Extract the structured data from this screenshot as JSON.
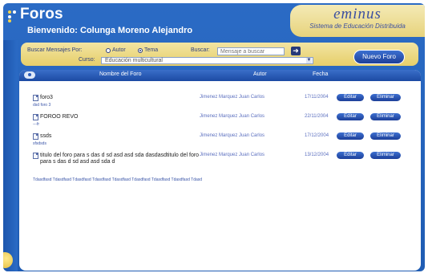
{
  "header": {
    "title": "Foros",
    "welcome": "Bienvenido: Colunga Moreno Alejandro",
    "brand_name": "eminus",
    "brand_subtitle": "Sistema de Educación Distribuida"
  },
  "search": {
    "label": "Buscar Mensajes Por:",
    "option_author": "Autor",
    "option_topic": "Tema",
    "selected_option": "Tema",
    "buscar_label": "Buscar:",
    "placeholder": "Mensaje a buscar",
    "course_label": "Curso:",
    "course_value": "Educación multicultural"
  },
  "actions": {
    "new_forum": "Nuevo Foro"
  },
  "table": {
    "columns": [
      "Nombre del Foro",
      "Autor",
      "Fecha"
    ],
    "rows": [
      {
        "title": "foro3",
        "sub": "dsd foro 3",
        "author": "Jimenez Marquez Juan Carlos",
        "date": "17/11/2004",
        "edit": "Editar",
        "delete": "Eliminar"
      },
      {
        "title": "FOROO REVO",
        "sub": "---fr",
        "author": "Jimenez Marquez Juan Carlos",
        "date": "22/11/2004",
        "edit": "Editar",
        "delete": "Eliminar"
      },
      {
        "title": "ssds",
        "sub": "sfsdsds",
        "author": "Jimenez Marquez Juan Carlos",
        "date": "17/12/2004",
        "edit": "Editar",
        "delete": "Eliminar"
      },
      {
        "title": "titulo del foro para s das d sd asd asd sda dasdasdtitulo del foro para s das d sd asd asd sda d",
        "sub": "Tdasdfasd Tdasdfasd Tdasdfasd Tdasdfasd Tdasdfasd Tdasdfasd Tdasdfasd Tdasdfasd Tdasd",
        "author": "Jimenez Marquez Juan Carlos",
        "date": "13/12/2004",
        "edit": "Editar",
        "delete": "Eliminar"
      }
    ]
  },
  "colors": {
    "frame": "#2b6bc5",
    "gold": "#e6cf6a",
    "button": "#1d3f99",
    "link_text": "#5b6fbf"
  }
}
